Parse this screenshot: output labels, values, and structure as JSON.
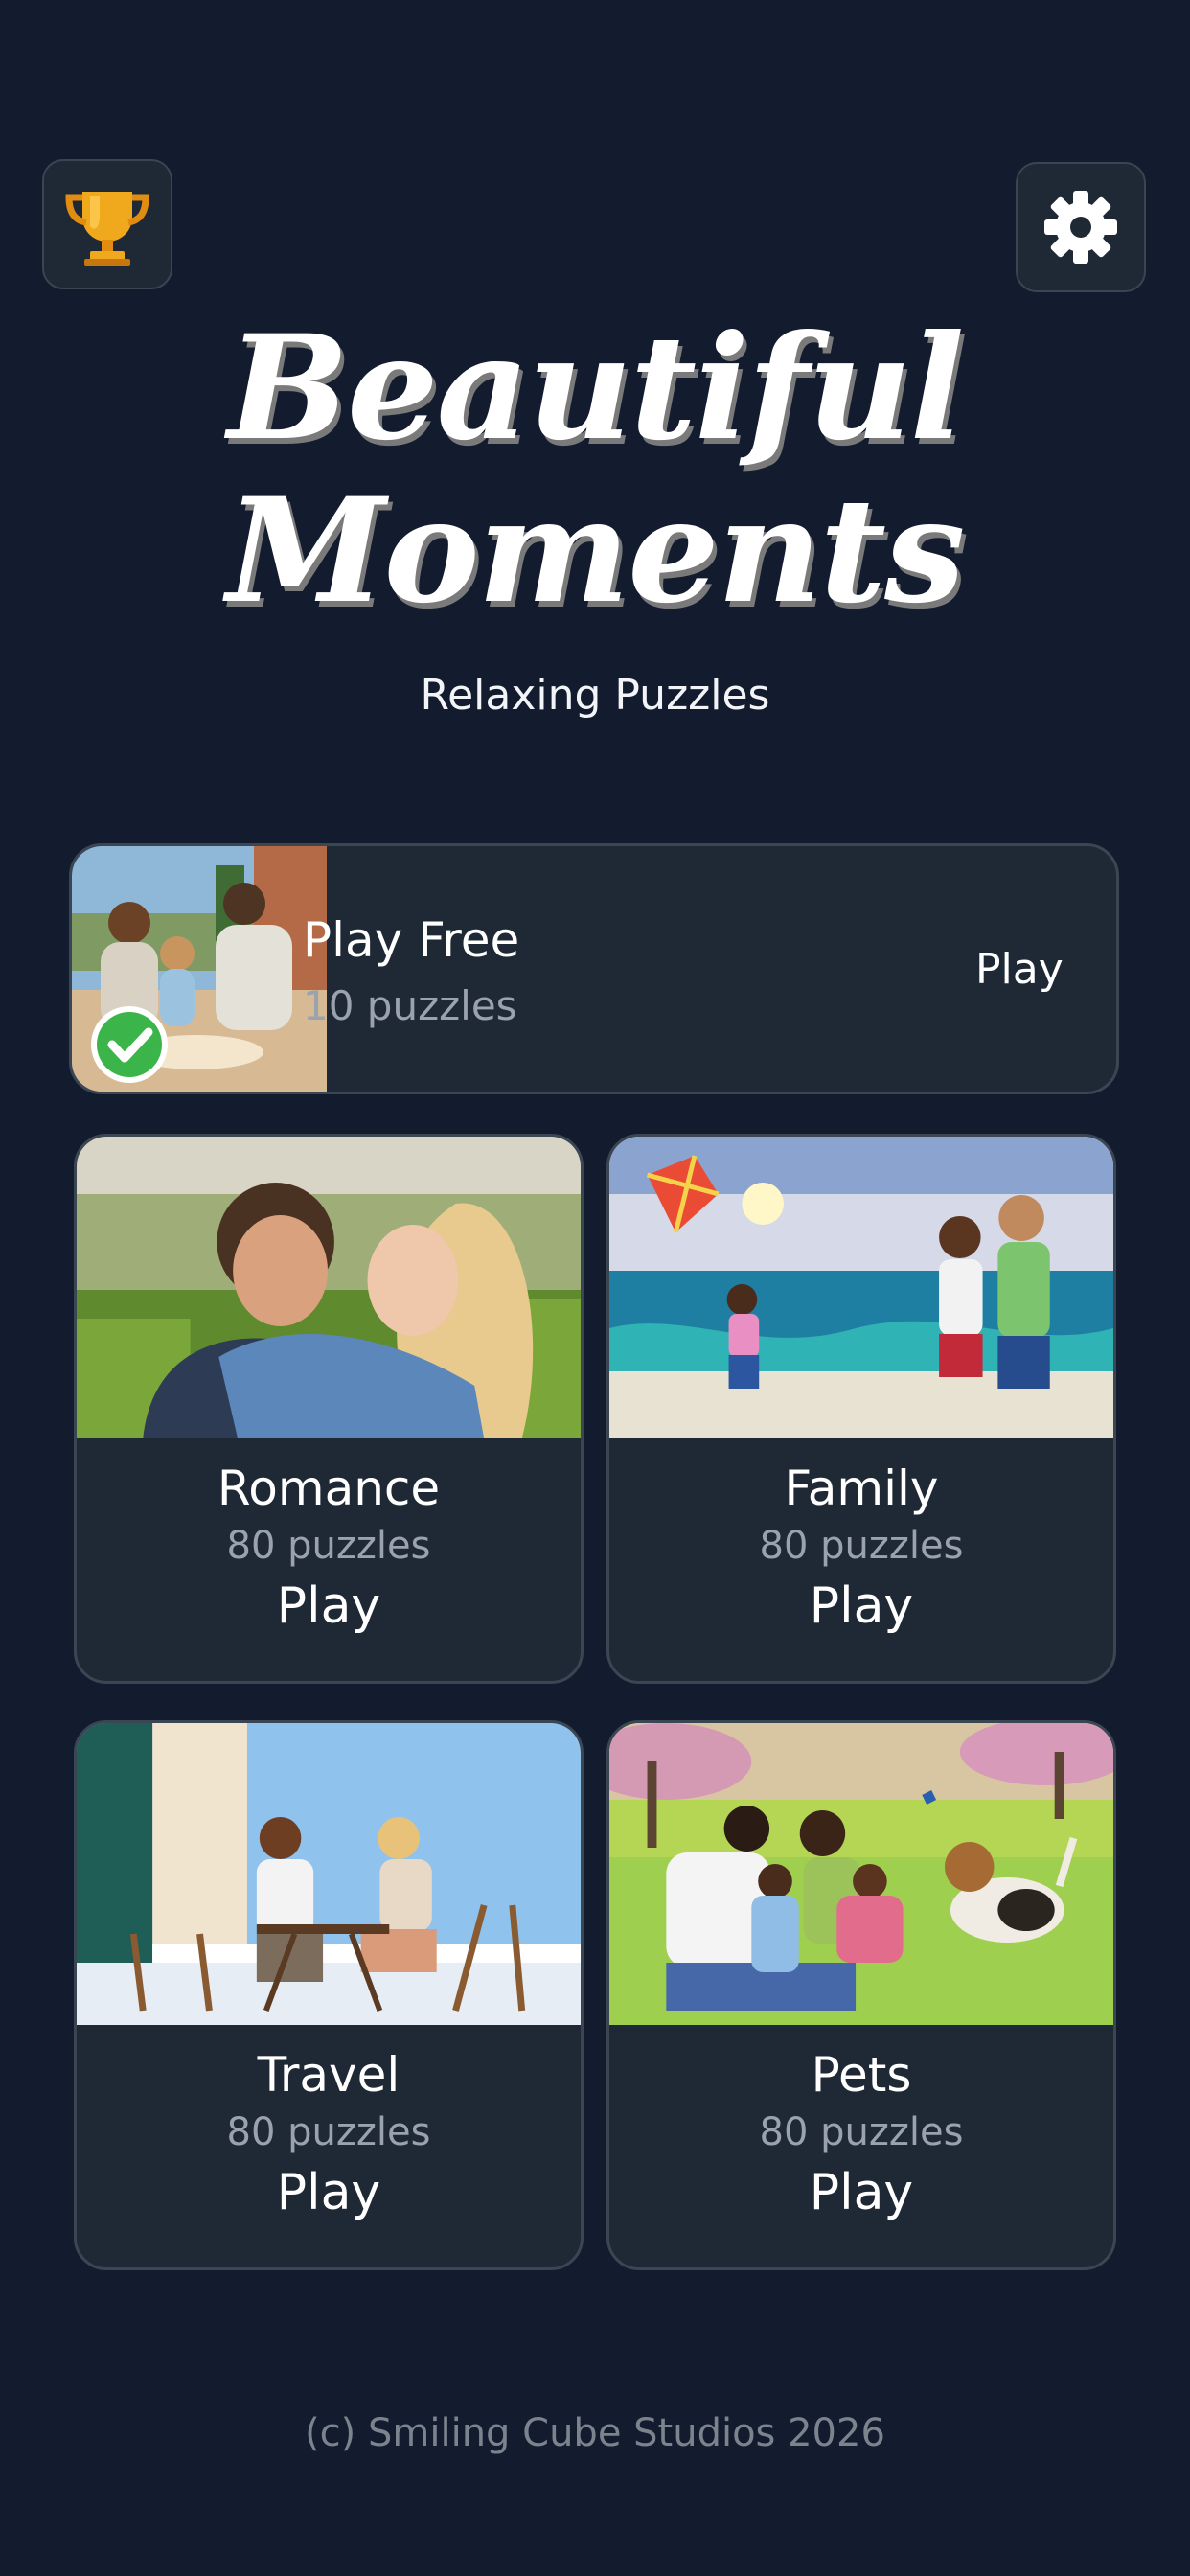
{
  "header": {
    "trophy_icon": "trophy-icon",
    "settings_icon": "gear-icon"
  },
  "logo": {
    "line1": "Beautiful",
    "line2": "Moments"
  },
  "subtitle": "Relaxing Puzzles",
  "free_pack": {
    "title": "Play Free",
    "count": "10 puzzles",
    "play_label": "Play",
    "completed": true,
    "badge_icon": "checkmark-icon"
  },
  "categories": [
    {
      "title": "Romance",
      "count": "80 puzzles",
      "play_label": "Play"
    },
    {
      "title": "Family",
      "count": "80 puzzles",
      "play_label": "Play"
    },
    {
      "title": "Travel",
      "count": "80 puzzles",
      "play_label": "Play"
    },
    {
      "title": "Pets",
      "count": "80 puzzles",
      "play_label": "Play"
    }
  ],
  "footer": "(c) Smiling Cube Studios 2026",
  "colors": {
    "background": "#131b2f",
    "card": "#1f2935",
    "card_border": "#3b4653",
    "muted_text": "#9aa3ad",
    "trophy_gold": "#f0a81c",
    "check_green": "#3bb54a"
  }
}
